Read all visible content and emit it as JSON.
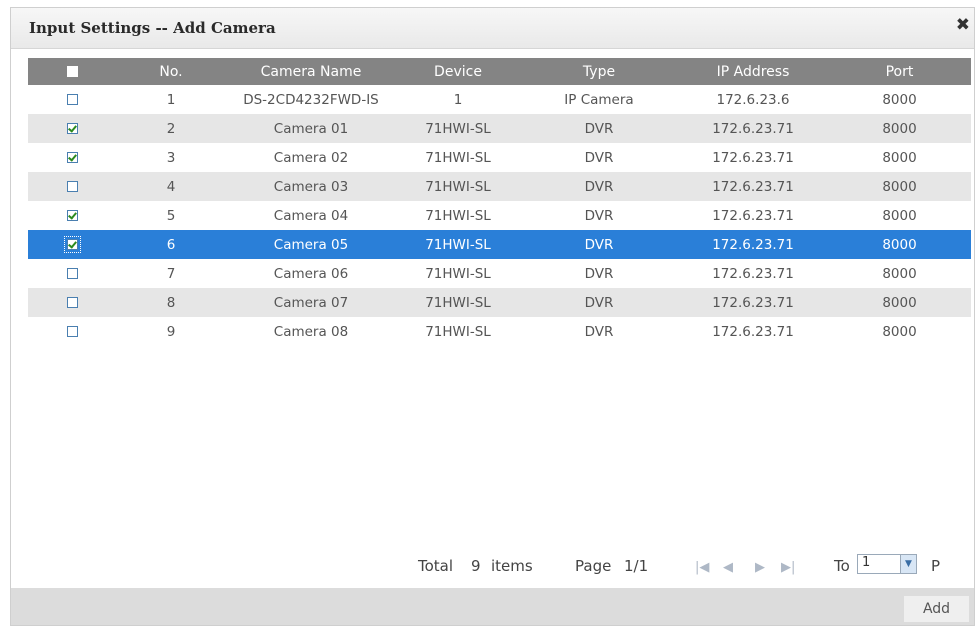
{
  "dialog": {
    "title": "Input Settings -- Add Camera",
    "close_icon": "close-icon"
  },
  "table": {
    "columns": [
      "No.",
      "Camera Name",
      "Device",
      "Type",
      "IP Address",
      "Port"
    ],
    "rows": [
      {
        "checked": false,
        "no": "1",
        "name": "DS-2CD4232FWD-IS",
        "device": "1",
        "type": "IP Camera",
        "ip": "172.6.23.6",
        "port": "8000"
      },
      {
        "checked": true,
        "no": "2",
        "name": "Camera 01",
        "device": "71HWI-SL",
        "type": "DVR",
        "ip": "172.6.23.71",
        "port": "8000"
      },
      {
        "checked": true,
        "no": "3",
        "name": "Camera 02",
        "device": "71HWI-SL",
        "type": "DVR",
        "ip": "172.6.23.71",
        "port": "8000"
      },
      {
        "checked": false,
        "no": "4",
        "name": "Camera 03",
        "device": "71HWI-SL",
        "type": "DVR",
        "ip": "172.6.23.71",
        "port": "8000"
      },
      {
        "checked": true,
        "no": "5",
        "name": "Camera 04",
        "device": "71HWI-SL",
        "type": "DVR",
        "ip": "172.6.23.71",
        "port": "8000"
      },
      {
        "checked": true,
        "no": "6",
        "name": "Camera 05",
        "device": "71HWI-SL",
        "type": "DVR",
        "ip": "172.6.23.71",
        "port": "8000",
        "selected": true
      },
      {
        "checked": false,
        "no": "7",
        "name": "Camera 06",
        "device": "71HWI-SL",
        "type": "DVR",
        "ip": "172.6.23.71",
        "port": "8000"
      },
      {
        "checked": false,
        "no": "8",
        "name": "Camera 07",
        "device": "71HWI-SL",
        "type": "DVR",
        "ip": "172.6.23.71",
        "port": "8000"
      },
      {
        "checked": false,
        "no": "9",
        "name": "Camera 08",
        "device": "71HWI-SL",
        "type": "DVR",
        "ip": "172.6.23.71",
        "port": "8000"
      }
    ]
  },
  "pager": {
    "total_label": "Total",
    "total_count": "9",
    "items_label": "items",
    "page_label": "Page",
    "page_value": "1/1",
    "nav_icons": [
      "first-page-icon",
      "prev-page-icon",
      "next-page-icon",
      "last-page-icon"
    ],
    "to_label": "To",
    "to_value": "1",
    "p_label": "P"
  },
  "footer": {
    "add_label": "Add"
  },
  "colors": {
    "header": "#848484",
    "alt_row": "#e6e6e6",
    "selected_row": "#2a7fd8",
    "check": "#2b8a1e"
  }
}
